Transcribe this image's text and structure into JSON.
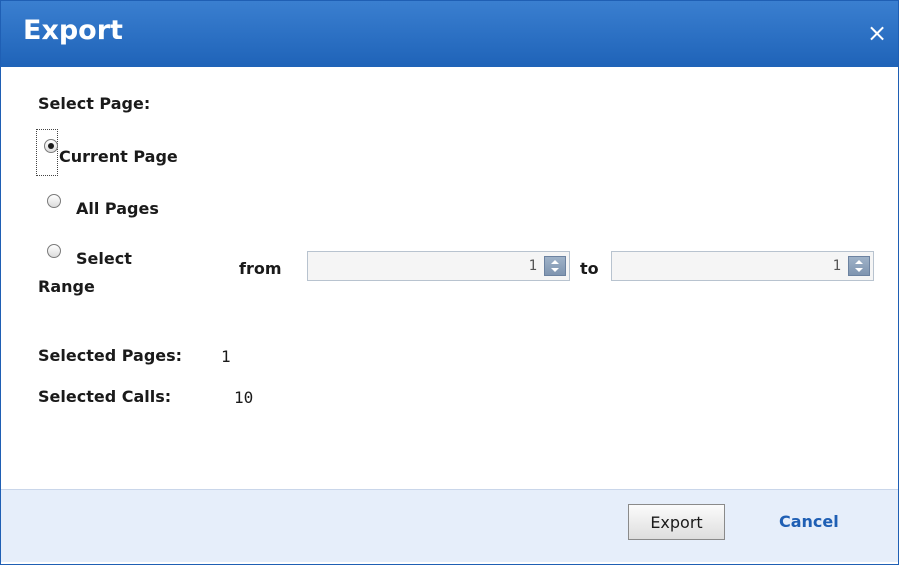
{
  "dialog": {
    "title": "Export",
    "close_symbol": "×"
  },
  "select_page": {
    "heading": "Select Page:",
    "options": [
      {
        "label": "Current Page",
        "selected": true
      },
      {
        "label": "All Pages",
        "selected": false
      },
      {
        "label_line1": "Select",
        "label_line2": "Range",
        "selected": false
      }
    ],
    "range": {
      "from_label": "from",
      "from_value": "1",
      "to_label": "to",
      "to_value": "1"
    }
  },
  "summary": {
    "selected_pages_label": "Selected Pages:",
    "selected_pages_value": "1",
    "selected_calls_label": "Selected Calls:",
    "selected_calls_value": "10"
  },
  "footer": {
    "export_label": "Export",
    "cancel_label": "Cancel"
  },
  "colors": {
    "titlebar": "#2b6fc4",
    "footer": "#e6eefa",
    "link": "#1f5fb4"
  },
  "icons": {
    "close": "close-icon",
    "spinner": "spinner-arrows-icon"
  }
}
